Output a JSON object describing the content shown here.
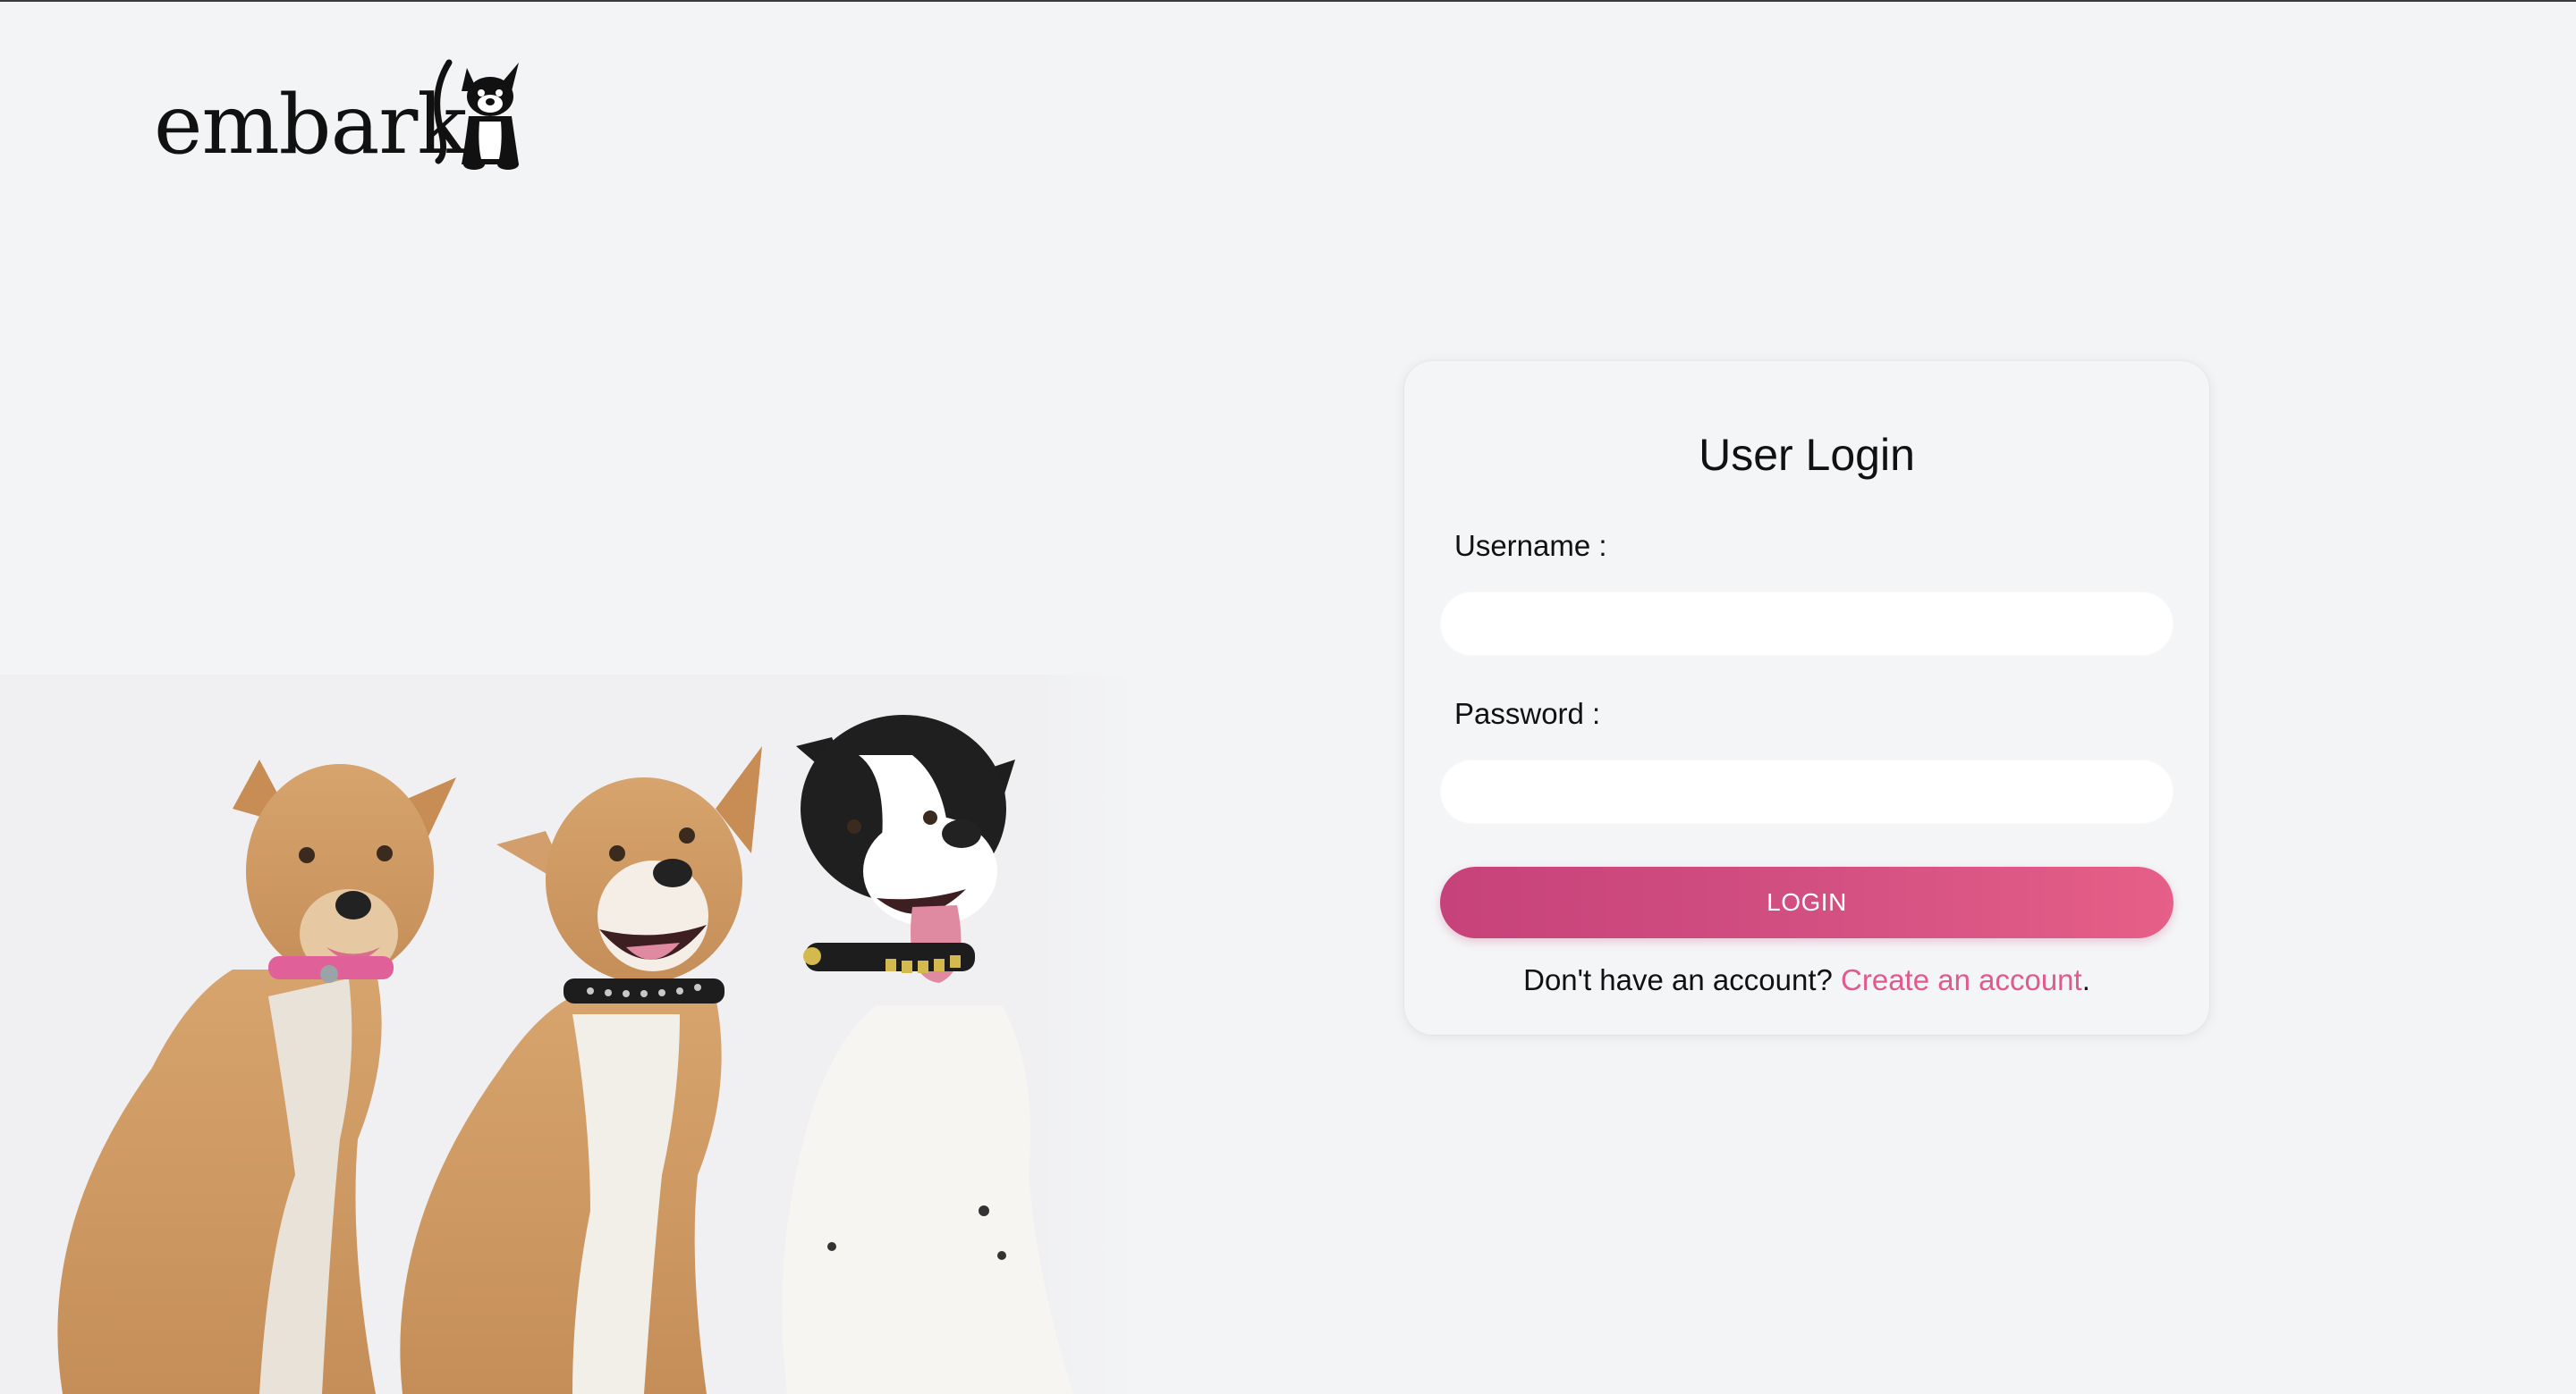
{
  "brand": {
    "name": "embark",
    "logo_icon": "dog-icon"
  },
  "illustration": {
    "icon": "three-dogs-illustration"
  },
  "login": {
    "title": "User Login",
    "username_label": "Username :",
    "username_value": "",
    "password_label": "Password :",
    "password_value": "",
    "button_label": "LOGIN",
    "signup_prompt": "Don't have an account? ",
    "signup_link": "Create an account",
    "signup_suffix": "."
  },
  "colors": {
    "background": "#f3f4f6",
    "accent": "#e05a8e",
    "button_gradient_start": "#c6427a",
    "button_gradient_end": "#e65f88"
  }
}
